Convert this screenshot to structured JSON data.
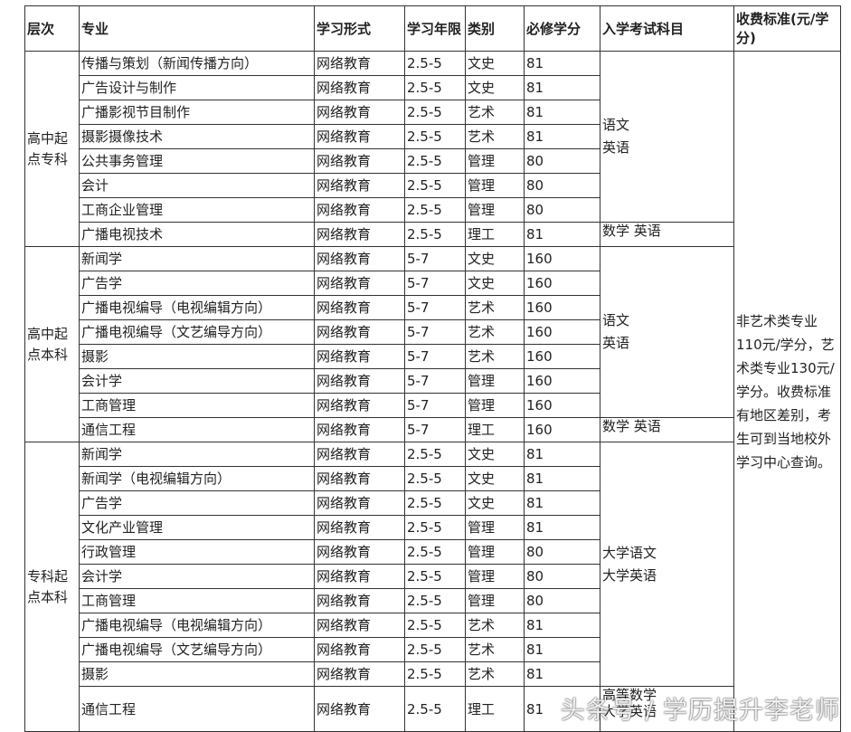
{
  "headers": {
    "level": "层次",
    "major": "专业",
    "form": "学习形式",
    "years": "学习年限",
    "category": "类别",
    "credits": "必修学分",
    "exam": "入学考试科目",
    "fee": "收费标准(元/学分)"
  },
  "groups": [
    {
      "level": "高中起点专科",
      "rows": [
        {
          "major": "传播与策划（新闻传播方向）",
          "form": "网络教育",
          "years": "2.5-5",
          "category": "文史",
          "credits": "81"
        },
        {
          "major": "广告设计与制作",
          "form": "网络教育",
          "years": "2.5-5",
          "category": "文史",
          "credits": "81"
        },
        {
          "major": "广播影视节目制作",
          "form": "网络教育",
          "years": "2.5-5",
          "category": "艺术",
          "credits": "81"
        },
        {
          "major": "摄影摄像技术",
          "form": "网络教育",
          "years": "2.5-5",
          "category": "艺术",
          "credits": "81"
        },
        {
          "major": "公共事务管理",
          "form": "网络教育",
          "years": "2.5-5",
          "category": "管理",
          "credits": "80"
        },
        {
          "major": "会计",
          "form": "网络教育",
          "years": "2.5-5",
          "category": "管理",
          "credits": "80"
        },
        {
          "major": "工商企业管理",
          "form": "网络教育",
          "years": "2.5-5",
          "category": "管理",
          "credits": "80"
        },
        {
          "major": "广播电视技术",
          "form": "网络教育",
          "years": "2.5-5",
          "category": "理工",
          "credits": "81"
        }
      ],
      "exam_main": [
        "语文",
        "英语"
      ],
      "exam_last": "数学  英语"
    },
    {
      "level": "高中起点本科",
      "rows": [
        {
          "major": "新闻学",
          "form": "网络教育",
          "years": "5-7",
          "category": "文史",
          "credits": "160"
        },
        {
          "major": "广告学",
          "form": "网络教育",
          "years": "5-7",
          "category": "文史",
          "credits": "160"
        },
        {
          "major": "广播电视编导（电视编辑方向）",
          "form": "网络教育",
          "years": "5-7",
          "category": "艺术",
          "credits": "160"
        },
        {
          "major": "广播电视编导（文艺编导方向）",
          "form": "网络教育",
          "years": "5-7",
          "category": "艺术",
          "credits": "160"
        },
        {
          "major": "摄影",
          "form": "网络教育",
          "years": "5-7",
          "category": "艺术",
          "credits": "160"
        },
        {
          "major": "会计学",
          "form": "网络教育",
          "years": "5-7",
          "category": "管理",
          "credits": "160"
        },
        {
          "major": "工商管理",
          "form": "网络教育",
          "years": "5-7",
          "category": "管理",
          "credits": "160"
        },
        {
          "major": "通信工程",
          "form": "网络教育",
          "years": "5-7",
          "category": "理工",
          "credits": "160"
        }
      ],
      "exam_main": [
        "语文",
        "英语"
      ],
      "exam_last": "数学  英语"
    },
    {
      "level": "专科起点本科",
      "rows": [
        {
          "major": "新闻学",
          "form": "网络教育",
          "years": "2.5-5",
          "category": "文史",
          "credits": "81"
        },
        {
          "major": "新闻学（电视编辑方向）",
          "form": "网络教育",
          "years": "2.5-5",
          "category": "文史",
          "credits": "81"
        },
        {
          "major": "广告学",
          "form": "网络教育",
          "years": "2.5-5",
          "category": "文史",
          "credits": "81"
        },
        {
          "major": "文化产业管理",
          "form": "网络教育",
          "years": "2.5-5",
          "category": "管理",
          "credits": "81"
        },
        {
          "major": "行政管理",
          "form": "网络教育",
          "years": "2.5-5",
          "category": "管理",
          "credits": "80"
        },
        {
          "major": "会计学",
          "form": "网络教育",
          "years": "2.5-5",
          "category": "管理",
          "credits": "80"
        },
        {
          "major": "工商管理",
          "form": "网络教育",
          "years": "2.5-5",
          "category": "管理",
          "credits": "80"
        },
        {
          "major": "广播电视编导（电视编辑方向）",
          "form": "网络教育",
          "years": "2.5-5",
          "category": "艺术",
          "credits": "81"
        },
        {
          "major": "广播电视编导（文艺编导方向）",
          "form": "网络教育",
          "years": "2.5-5",
          "category": "艺术",
          "credits": "81"
        },
        {
          "major": "摄影",
          "form": "网络教育",
          "years": "2.5-5",
          "category": "艺术",
          "credits": "81"
        },
        {
          "major": "通信工程",
          "form": "网络教育",
          "years": "2.5-5",
          "category": "理工",
          "credits": "81"
        }
      ],
      "exam_main": [
        "大学语文",
        "大学英语"
      ],
      "exam_last": "高等数学\n大学英语"
    }
  ],
  "fee_note": "非艺术类专业110元/学分，艺术类专业130元/学分。收费标准有地区差别，考生可到当地校外学习中心查询。",
  "watermark": "头条号 / 学历提升李老师"
}
